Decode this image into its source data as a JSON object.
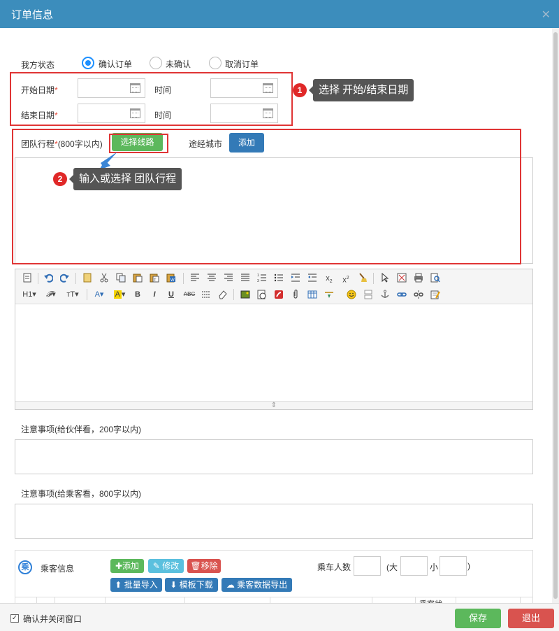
{
  "window": {
    "title": "订单信息",
    "close": "✕"
  },
  "status": {
    "label": "我方状态",
    "options": [
      "确认订单",
      "未确认",
      "取消订单"
    ],
    "selected": 0
  },
  "dates": {
    "start_label": "开始日期",
    "end_label": "结束日期",
    "time_label": "时间",
    "required_mark": "*"
  },
  "callouts": [
    {
      "number": "1",
      "text": "选择 开始/结束日期"
    },
    {
      "number": "2",
      "text": "输入或选择 团队行程"
    }
  ],
  "itinerary": {
    "label": "团队行程",
    "required_mark": "*",
    "hint": "(800字以内)",
    "select_route_button": "选择线路",
    "via_city_label": "途经城市",
    "add_button": "添加"
  },
  "editor": {
    "toolbar_row2_text": [
      "H1",
      "𝓕",
      "тT",
      "A",
      "A",
      "B",
      "I",
      "U",
      "ABC"
    ],
    "resize_handle": "⇕"
  },
  "notes_partner": {
    "label": "注意事项(给伙伴看，200字以内)"
  },
  "notes_passenger": {
    "label": "注意事项(给乘客看，800字以内)"
  },
  "passengers": {
    "icon_text": "乘",
    "title": "乘客信息",
    "add": "添加",
    "edit": "修改",
    "remove": "移除",
    "bulk_import": "批量导入",
    "template_download": "模板下载",
    "export": "乘客数据导出",
    "count_label": "乘车人数",
    "adult_open": "(大",
    "child_label": "小",
    "close_paren": ")",
    "table_header_partial": "乘客状"
  },
  "footer": {
    "confirm_close_label": "确认并关闭窗口",
    "confirm_checked": true,
    "save": "保存",
    "exit": "退出"
  }
}
